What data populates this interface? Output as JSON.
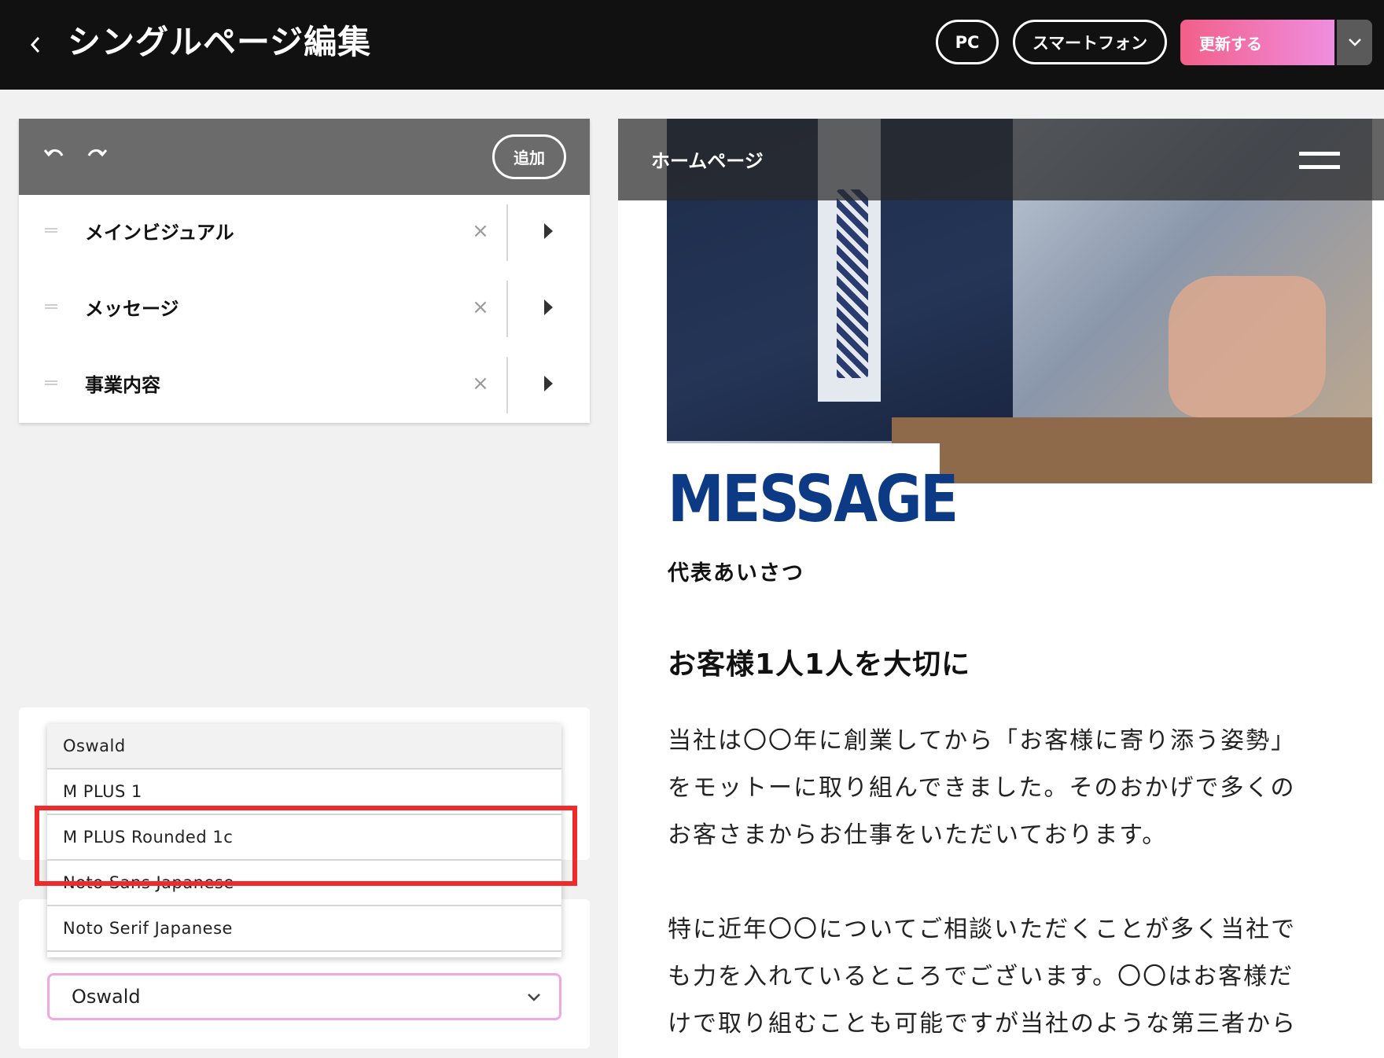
{
  "header": {
    "title": "シングルページ編集",
    "pc_label": "PC",
    "smartphone_label": "スマートフォン",
    "update_label": "更新する"
  },
  "section_panel": {
    "add_label": "追加",
    "items": [
      {
        "label": "メインビジュアル"
      },
      {
        "label": "メッセージ"
      },
      {
        "label": "事業内容"
      }
    ]
  },
  "font_dropdown": {
    "options": [
      "Oswald",
      "M PLUS 1",
      "M PLUS Rounded 1c",
      "Noto Sans Japanese",
      "Noto Serif Japanese"
    ],
    "selected": "Oswald",
    "highlighted_option": "M PLUS Rounded 1c"
  },
  "preview": {
    "site_title": "ホームページ",
    "message_title": "MESSAGE",
    "message_subtitle": "代表あいさつ",
    "heading": "お客様1人1人を大切に",
    "paragraph1": [
      "当社は〇〇年に創業してから「お客様に寄り添う姿勢」",
      "をモットーに取り組んできました。そのおかげで多くの",
      "お客さまからお仕事をいただいております。"
    ],
    "paragraph2": [
      "特に近年〇〇についてご相談いただくことが多く当社で",
      "も力を入れているところでございます。〇〇はお客様だ",
      "けで取り組むことも可能ですが当社のような第三者から"
    ]
  },
  "colors": {
    "topbar_bg": "#111111",
    "update_gradient_start": "#f25f89",
    "update_gradient_end": "#f08de0",
    "message_title": "#0d3a84",
    "highlight_box": "#ee2a2a",
    "select_border": "#f0a7e2"
  },
  "icons": [
    "back-chevron-icon",
    "undo-icon",
    "redo-icon",
    "drag-handle-icon",
    "close-icon",
    "expand-triangle-icon",
    "chevron-down-icon",
    "hamburger-menu-icon"
  ]
}
